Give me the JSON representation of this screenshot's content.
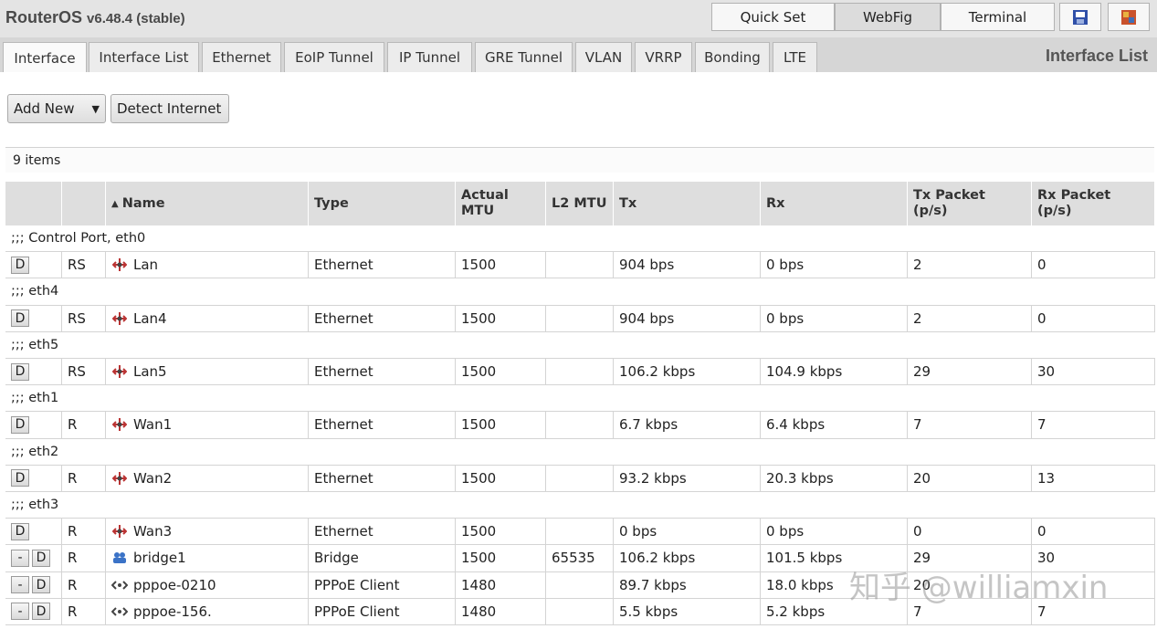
{
  "header": {
    "brand": "RouterOS",
    "version": "v6.48.4 (stable)",
    "modes": [
      "Quick Set",
      "WebFig",
      "Terminal"
    ],
    "active_mode": "WebFig"
  },
  "tabs": [
    "Interface",
    "Interface List",
    "Ethernet",
    "EoIP Tunnel",
    "IP Tunnel",
    "GRE Tunnel",
    "VLAN",
    "VRRP",
    "Bonding",
    "LTE"
  ],
  "active_tab": "Interface",
  "page_title": "Interface List",
  "toolbar": {
    "add_new": "Add New",
    "add_new_arrow": "▼",
    "detect_internet": "Detect Internet"
  },
  "item_count": "9 items",
  "table": {
    "sort_indicator": "▲",
    "headers": {
      "name": "Name",
      "type": "Type",
      "actual_mtu": [
        "Actual",
        "MTU"
      ],
      "l2_mtu": "L2 MTU",
      "tx": "Tx",
      "rx": "Rx",
      "tx_packet": [
        "Tx Packet",
        "(p/s)"
      ],
      "rx_packet": [
        "Rx Packet",
        "(p/s)"
      ]
    },
    "rows": [
      {
        "comment": ";;; Control Port, eth0"
      },
      {
        "buttons": [
          "D"
        ],
        "flags": "RS",
        "icon": "ethernet-icon",
        "name": "Lan",
        "type": "Ethernet",
        "actual_mtu": "1500",
        "l2_mtu": "",
        "tx": "904 bps",
        "rx": "0 bps",
        "tx_pps": "2",
        "rx_pps": "0"
      },
      {
        "comment": ";;; eth4"
      },
      {
        "buttons": [
          "D"
        ],
        "flags": "RS",
        "icon": "ethernet-icon",
        "name": "Lan4",
        "type": "Ethernet",
        "actual_mtu": "1500",
        "l2_mtu": "",
        "tx": "904 bps",
        "rx": "0 bps",
        "tx_pps": "2",
        "rx_pps": "0"
      },
      {
        "comment": ";;; eth5"
      },
      {
        "buttons": [
          "D"
        ],
        "flags": "RS",
        "icon": "ethernet-icon",
        "name": "Lan5",
        "type": "Ethernet",
        "actual_mtu": "1500",
        "l2_mtu": "",
        "tx": "106.2 kbps",
        "rx": "104.9 kbps",
        "tx_pps": "29",
        "rx_pps": "30"
      },
      {
        "comment": ";;; eth1"
      },
      {
        "buttons": [
          "D"
        ],
        "flags": "R",
        "icon": "ethernet-icon",
        "name": "Wan1",
        "type": "Ethernet",
        "actual_mtu": "1500",
        "l2_mtu": "",
        "tx": "6.7 kbps",
        "rx": "6.4 kbps",
        "tx_pps": "7",
        "rx_pps": "7"
      },
      {
        "comment": ";;; eth2"
      },
      {
        "buttons": [
          "D"
        ],
        "flags": "R",
        "icon": "ethernet-icon",
        "name": "Wan2",
        "type": "Ethernet",
        "actual_mtu": "1500",
        "l2_mtu": "",
        "tx": "93.2 kbps",
        "rx": "20.3 kbps",
        "tx_pps": "20",
        "rx_pps": "13"
      },
      {
        "comment": ";;; eth3"
      },
      {
        "buttons": [
          "D"
        ],
        "flags": "R",
        "icon": "ethernet-icon",
        "name": "Wan3",
        "type": "Ethernet",
        "actual_mtu": "1500",
        "l2_mtu": "",
        "tx": "0 bps",
        "rx": "0 bps",
        "tx_pps": "0",
        "rx_pps": "0"
      },
      {
        "buttons": [
          "-",
          "D"
        ],
        "flags": "R",
        "icon": "bridge-icon",
        "name": "bridge1",
        "type": "Bridge",
        "actual_mtu": "1500",
        "l2_mtu": "65535",
        "tx": "106.2 kbps",
        "rx": "101.5 kbps",
        "tx_pps": "29",
        "rx_pps": "30"
      },
      {
        "buttons": [
          "-",
          "D"
        ],
        "flags": "R",
        "icon": "pppoe-icon",
        "name": "pppoe-0210",
        "type": "PPPoE Client",
        "actual_mtu": "1480",
        "l2_mtu": "",
        "tx": "89.7 kbps",
        "rx": "18.0 kbps",
        "tx_pps": "20",
        "rx_pps": ""
      },
      {
        "buttons": [
          "-",
          "D"
        ],
        "flags": "R",
        "icon": "pppoe-icon",
        "name": "pppoe-156.",
        "type": "PPPoE Client",
        "actual_mtu": "1480",
        "l2_mtu": "",
        "tx": "5.5 kbps",
        "rx": "5.2 kbps",
        "tx_pps": "7",
        "rx_pps": "7"
      }
    ]
  },
  "watermark": "知乎 @williamxin"
}
